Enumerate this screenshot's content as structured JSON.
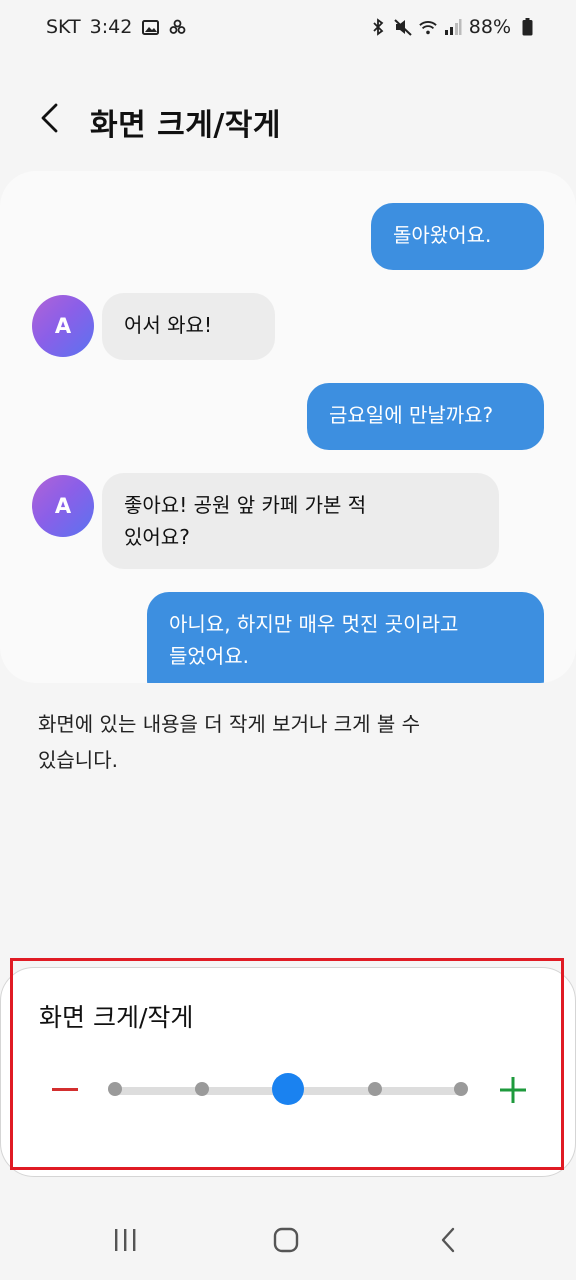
{
  "status_bar": {
    "carrier": "SKT",
    "time": "3:42",
    "battery": "88%",
    "left_icons": [
      "image-icon",
      "pinwheel-icon"
    ],
    "right_icons": [
      "bluetooth-icon",
      "mute-icon",
      "wifi-icon",
      "signal-icon",
      "battery-icon"
    ]
  },
  "header": {
    "title": "화면 크게/작게",
    "back_icon": "chevron-left-icon"
  },
  "preview": {
    "avatar_letter": "A",
    "messages": [
      {
        "side": "out",
        "text": "돌아왔어요."
      },
      {
        "side": "in",
        "text": "어서 와요!"
      },
      {
        "side": "out",
        "text": "금요일에 만날까요?"
      },
      {
        "side": "in",
        "text_line1": "좋아요! 공원 앞 카페 가본 적",
        "text_line2": "있어요?"
      },
      {
        "side": "out",
        "text_line1": "아니요, 하지만 매우 멋진 곳이라고",
        "text_line2": "들었어요."
      }
    ]
  },
  "description": {
    "line1": "화면에 있는 내용을 더 작게 보거나 크게 볼 수",
    "line2": "있습니다."
  },
  "size_panel": {
    "title": "화면 크게/작게",
    "step_count": 5,
    "selected_index": 2,
    "colors": {
      "minus": "#d32f2f",
      "plus": "#1e9a3c",
      "thumb": "#1a82f0",
      "highlight": "#e01b24"
    }
  },
  "nav_bar": {
    "icons": [
      "recent-apps-icon",
      "home-icon",
      "back-icon"
    ]
  }
}
